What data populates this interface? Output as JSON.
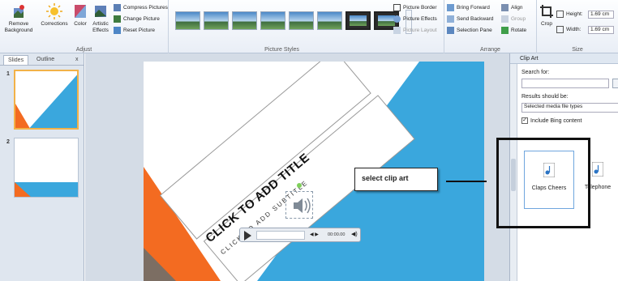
{
  "ribbon": {
    "adjust": {
      "remove_background": "Remove Background",
      "corrections": "Corrections",
      "color": "Color",
      "artistic_effects": "Artistic Effects",
      "compress_pictures": "Compress Pictures",
      "change_picture": "Change Picture",
      "reset_picture": "Reset Picture",
      "group_label": "Adjust"
    },
    "picture_styles": {
      "group_label": "Picture Styles"
    },
    "style_options": {
      "picture_border": "Picture Border",
      "picture_effects": "Picture Effects",
      "picture_layout": "Picture Layout"
    },
    "arrange": {
      "bring_forward": "Bring Forward",
      "send_backward": "Send Backward",
      "selection_pane": "Selection Pane",
      "align": "Align",
      "group": "Group",
      "rotate": "Rotate",
      "group_label": "Arrange"
    },
    "size": {
      "crop": "Crop",
      "height_label": "Height:",
      "height_value": "1.69 cm",
      "width_label": "Width:",
      "width_value": "1.69 cm",
      "group_label": "Size"
    }
  },
  "left_pane": {
    "tab_slides": "Slides",
    "tab_outline": "Outline",
    "close": "x",
    "slides": [
      "1",
      "2"
    ]
  },
  "slide": {
    "title": "CLICK TO ADD TITLE",
    "subtitle": "CLICK TO ADD SUBTITLE",
    "media_time": "00:00.00"
  },
  "annotation": {
    "callout": "select clip art"
  },
  "clip_art": {
    "title": "Clip Art",
    "search_label": "Search for:",
    "search_value": "",
    "results_label": "Results should be:",
    "results_value": "Selected media file types",
    "include_bing": "Include Bing content",
    "include_bing_checked": true,
    "results": [
      "Claps Cheers",
      "Telephone"
    ]
  },
  "colors": {
    "orange": "#f36b21",
    "blue": "#3aa7dd",
    "ribbon": "#e9eef6"
  }
}
